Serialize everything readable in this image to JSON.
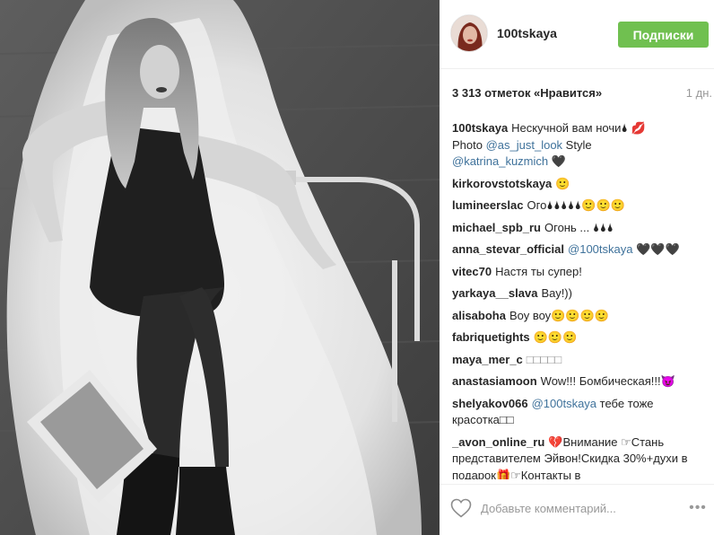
{
  "post": {
    "username": "100tskaya",
    "follow_label": "Подписки",
    "likes": "3 313 отметок «Нравится»",
    "time": "1 дн.",
    "caption": {
      "user": "100tskaya",
      "line1": "Нескучной вам ночи🌢 💋",
      "line2a": "Photo ",
      "mention1": "@as_just_look",
      "line2b": " Style",
      "mention2": "@katrina_kuzmich",
      "line3b": " 🖤"
    },
    "comments": [
      {
        "user": "kirkorovstotskaya",
        "text": "🙂"
      },
      {
        "user": "lumineerslac",
        "text": "Ого🌢🌢🌢🌢🌢🙂🙂🙂"
      },
      {
        "user": "michael_spb_ru",
        "text": "Огонь ... 🌢🌢🌢"
      },
      {
        "user": "anna_stevar_official",
        "mention": "@100tskaya",
        "text": " 🖤🖤🖤"
      },
      {
        "user": "vitec70",
        "text": "Настя ты супер!"
      },
      {
        "user": "yarkaya__slava",
        "text": "Вау!))"
      },
      {
        "user": "alisaboha",
        "text": "Воу воу🙂🙂🙂🙂"
      },
      {
        "user": "fabriquetights",
        "text": "🙂🙂🙂"
      },
      {
        "user": "maya_mer_c",
        "text": "□□□□□"
      },
      {
        "user": "anastasiamoon",
        "text": "Wow!!! Бомбическая!!!😈"
      },
      {
        "user": "shelyakov066",
        "mention": "@100tskaya",
        "text": " тебе тоже красотка□□"
      },
      {
        "user": "_avon_online_ru",
        "text": "💔Внимание ☞Стань представителем Эйвон!Скидка 30%+духи в подарок🎁☞Контакты в"
      }
    ],
    "comment_placeholder": "Добавьте комментарий...",
    "more_label": "•••"
  },
  "icons": {
    "heart": "heart-outline-icon",
    "more": "more-options-icon"
  },
  "colors": {
    "follow_button": "#70c050",
    "mention": "#3f729b",
    "muted": "#999999"
  }
}
